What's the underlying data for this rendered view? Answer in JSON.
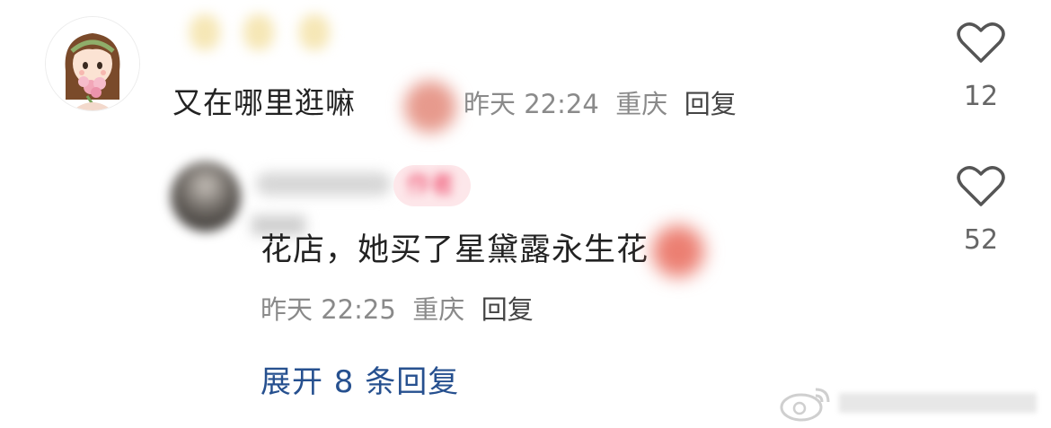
{
  "comment": {
    "text": "又在哪里逛嘛",
    "time": "昨天 22:24",
    "location": "重庆",
    "reply_label": "回复",
    "likes": "12"
  },
  "reply": {
    "badge": "作者",
    "text": "花店，她买了星黛露永生花",
    "time": "昨天 22:25",
    "location": "重庆",
    "reply_label": "回复",
    "likes": "52"
  },
  "expand_replies": "展开 8 条回复",
  "icons": {
    "like": "heart-outline-icon",
    "watermark": "weibo-logo-icon"
  },
  "colors": {
    "text": "#222222",
    "meta": "#8a8a8a",
    "link": "#26508f",
    "badge_bg": "#fde7ea",
    "badge_fg": "#ee4466"
  }
}
